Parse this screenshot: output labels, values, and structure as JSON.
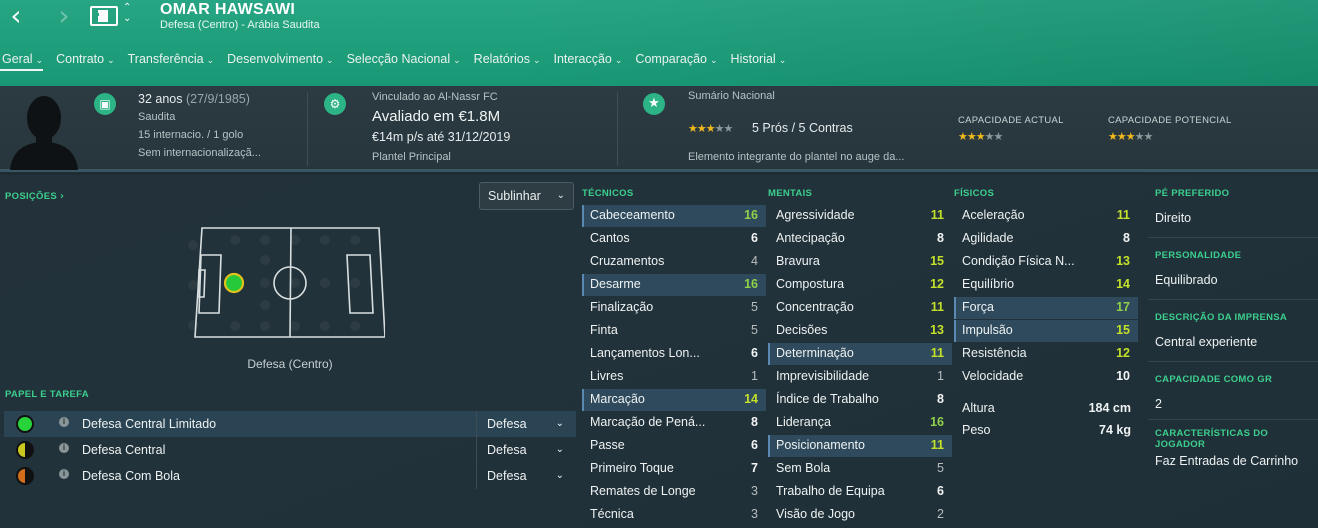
{
  "header": {
    "back_icon": "chevron-left-icon",
    "forward_icon": "chevron-right-icon",
    "name": "OMAR HAWSAWI",
    "subtitle": "Defesa (Centro) - Arábia Saudita",
    "tabs": [
      {
        "label": "Geral",
        "active": true
      },
      {
        "label": "Contrato"
      },
      {
        "label": "Transferência"
      },
      {
        "label": "Desenvolvimento"
      },
      {
        "label": "Selecção Nacional"
      },
      {
        "label": "Relatórios"
      },
      {
        "label": "Interacção"
      },
      {
        "label": "Comparação"
      },
      {
        "label": "Historial"
      }
    ]
  },
  "info": {
    "age": "32 anos",
    "dob": "(27/9/1985)",
    "nationality": "Saudita",
    "caps": "15 internacio. / 1 golo",
    "intl_status": "Sem internacionalizaçã...",
    "club_link": "Vinculado ao Al-Nassr FC",
    "value": "Avaliado em €1.8M",
    "wage": "€14m p/s até 31/12/2019",
    "squad": "Plantel Principal",
    "national_title": "Sumário Nacional",
    "national_rating": {
      "stars": 3,
      "max": 5
    },
    "pros_cons": "5 Prós / 5 Contras",
    "national_desc": "Elemento integrante do plantel no auge da...",
    "current_ability_label": "CAPACIDADE ACTUAL",
    "current_ability_stars": 3,
    "potential_ability_label": "CAPACIDADE POTENCIAL",
    "potential_ability_stars": 3
  },
  "positions": {
    "title": "POSIÇÕES",
    "highlight_mode": "Sublinhar",
    "label": "Defesa (Centro)"
  },
  "roles": {
    "title": "PAPEL E TAREFA",
    "items": [
      {
        "name": "Defesa Central Limitado",
        "duty": "Defesa",
        "color": "#29d33b",
        "selected": true
      },
      {
        "name": "Defesa Central",
        "duty": "Defesa",
        "color": "#c8c81e",
        "selected": false
      },
      {
        "name": "Defesa Com Bola",
        "duty": "Defesa",
        "color": "#d26d1a",
        "selected": false
      }
    ]
  },
  "attributes": {
    "tecnicos_title": "TÉCNICOS",
    "mentais_title": "MENTAIS",
    "fisicos_title": "FÍSICOS",
    "tecnicos": [
      {
        "name": "Cabeceamento",
        "value": "16",
        "hl": true
      },
      {
        "name": "Cantos",
        "value": "6"
      },
      {
        "name": "Cruzamentos",
        "value": "4"
      },
      {
        "name": "Desarme",
        "value": "16",
        "hl": true
      },
      {
        "name": "Finalização",
        "value": "5"
      },
      {
        "name": "Finta",
        "value": "5"
      },
      {
        "name": "Lançamentos Lon...",
        "value": "6"
      },
      {
        "name": "Livres",
        "value": "1"
      },
      {
        "name": "Marcação",
        "value": "14",
        "hl": true
      },
      {
        "name": "Marcação de Pená...",
        "value": "8"
      },
      {
        "name": "Passe",
        "value": "6"
      },
      {
        "name": "Primeiro Toque",
        "value": "7"
      },
      {
        "name": "Remates de Longe",
        "value": "3"
      },
      {
        "name": "Técnica",
        "value": "3"
      }
    ],
    "mentais": [
      {
        "name": "Agressividade",
        "value": "11"
      },
      {
        "name": "Antecipação",
        "value": "8"
      },
      {
        "name": "Bravura",
        "value": "15"
      },
      {
        "name": "Compostura",
        "value": "12"
      },
      {
        "name": "Concentração",
        "value": "11"
      },
      {
        "name": "Decisões",
        "value": "13"
      },
      {
        "name": "Determinação",
        "value": "11",
        "hl": true
      },
      {
        "name": "Imprevisibilidade",
        "value": "1"
      },
      {
        "name": "Índice de Trabalho",
        "value": "8"
      },
      {
        "name": "Liderança",
        "value": "16"
      },
      {
        "name": "Posicionamento",
        "value": "11",
        "hl": true
      },
      {
        "name": "Sem Bola",
        "value": "5"
      },
      {
        "name": "Trabalho de Equipa",
        "value": "6"
      },
      {
        "name": "Visão de Jogo",
        "value": "2"
      }
    ],
    "fisicos": [
      {
        "name": "Aceleração",
        "value": "11"
      },
      {
        "name": "Agilidade",
        "value": "8"
      },
      {
        "name": "Condição Física N...",
        "value": "13"
      },
      {
        "name": "Equilíbrio",
        "value": "14"
      },
      {
        "name": "Força",
        "value": "17",
        "hl": true
      },
      {
        "name": "Impulsão",
        "value": "15",
        "hl": true
      },
      {
        "name": "Resistência",
        "value": "12"
      },
      {
        "name": "Velocidade",
        "value": "10"
      }
    ],
    "height_label": "Altura",
    "height": "184 cm",
    "weight_label": "Peso",
    "weight": "74 kg"
  },
  "profile": {
    "foot_title": "PÉ PREFERIDO",
    "foot": "Direito",
    "personality_title": "PERSONALIDADE",
    "personality": "Equilibrado",
    "press_title": "DESCRIÇÃO DA IMPRENSA",
    "press": "Central experiente",
    "gk_title": "CAPACIDADE COMO GR",
    "gk": "2",
    "traits_title": "CARACTERÍSTICAS DO JOGADOR",
    "traits": "Faz Entradas de Carrinho"
  },
  "colors": {
    "header": "#1aa07c",
    "accent_green": "#3ccf8e",
    "star": "#f0b81c"
  }
}
